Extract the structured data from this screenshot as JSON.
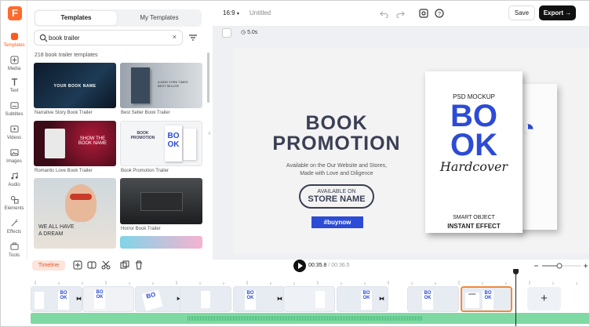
{
  "rail": {
    "logo": "F",
    "items": [
      {
        "label": "Templates",
        "icon": "templates-icon"
      },
      {
        "label": "Media",
        "icon": "media-icon"
      },
      {
        "label": "Text",
        "icon": "text-icon"
      },
      {
        "label": "Subtitles",
        "icon": "subtitles-icon"
      },
      {
        "label": "Videos",
        "icon": "videos-icon"
      },
      {
        "label": "Images",
        "icon": "images-icon"
      },
      {
        "label": "Audio",
        "icon": "audio-icon"
      },
      {
        "label": "Elements",
        "icon": "elements-icon"
      },
      {
        "label": "Effects",
        "icon": "effects-icon"
      },
      {
        "label": "Tools",
        "icon": "tools-icon"
      }
    ]
  },
  "panel": {
    "tabs": [
      "Templates",
      "My Templates"
    ],
    "search_value": "book trailer",
    "clear": "×",
    "count": "218 book trailer templates",
    "templates": [
      {
        "title": "Narrative Story Book Trailer",
        "caption": "YOUR BOOK NAME"
      },
      {
        "title": "Best Seller Book Trailer",
        "caption": "A NEW YORK TIMES BEST SELLER"
      },
      {
        "title": "Romantic Love Book Trailer",
        "caption": "SHOW THE BOOK NAME"
      },
      {
        "title": "Book Promotion Trailer",
        "caption": "BOOK PROMOTION"
      },
      {
        "title": "",
        "caption": "WE ALL HAVE A DREAM"
      },
      {
        "title": "Horror Book Trailer",
        "caption": ""
      }
    ]
  },
  "topbar": {
    "ratio": "16:9",
    "title": "Untitled",
    "save": "Save",
    "export": "Export"
  },
  "canvas": {
    "duration": "5.0s",
    "headline_1": "BOOK",
    "headline_2": "PROMOTION",
    "subtitle_1": "Available on the Our Website and Stores,",
    "subtitle_2": "Made with Love and Diligence",
    "store_small": "AVAILABLE ON",
    "store_big": "STORE NAME",
    "hashtag": "#buynow",
    "book": {
      "top": "PSD MOCKUP",
      "b1": "BO",
      "b2": "OK",
      "script": "Hardcover",
      "b3": "SMART OBJECT",
      "b4": "INSTANT EFFECT"
    },
    "accent": "#2c4bd6"
  },
  "timeline": {
    "label": "Timeline",
    "current": "00:35.8",
    "total": "00:36.5",
    "add": "+"
  }
}
